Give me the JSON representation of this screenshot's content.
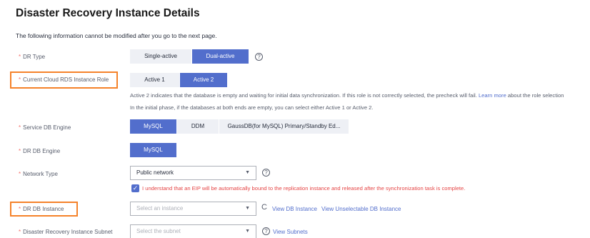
{
  "page": {
    "title": "Disaster Recovery Instance Details",
    "subtitle": "The following information cannot be modified after you go to the next page."
  },
  "fields": {
    "dr_type": {
      "label": "DR Type",
      "options": [
        "Single-active",
        "Dual-active"
      ],
      "selected": "Dual-active"
    },
    "rds_role": {
      "label": "Current Cloud RDS Instance Role",
      "options": [
        "Active 1",
        "Active 2"
      ],
      "selected": "Active 2",
      "note_prefix": "Active 2 indicates that the database is empty and waiting for initial data synchronization. If this role is not correctly selected, the precheck will fail.",
      "note_link": "Learn more",
      "note_suffix": "about the role selection",
      "note2": "In the initial phase, if the databases at both ends are empty, you can select either Active 1 or Active 2."
    },
    "service_engine": {
      "label": "Service DB Engine",
      "options": [
        "MySQL",
        "DDM",
        "GaussDB(for MySQL) Primary/Standby Ed..."
      ],
      "selected": "MySQL"
    },
    "dr_engine": {
      "label": "DR DB Engine",
      "options": [
        "MySQL"
      ],
      "selected": "MySQL"
    },
    "network_type": {
      "label": "Network Type",
      "value": "Public network",
      "checkbox_text": "I understand that an EIP will be automatically bound to the replication instance and released after the synchronization task is complete."
    },
    "dr_instance": {
      "label": "DR DB Instance",
      "placeholder": "Select an instance",
      "link_view": "View DB Instance",
      "link_unselectable": "View Unselectable DB Instance"
    },
    "subnet": {
      "label": "Disaster Recovery Instance Subnet",
      "placeholder": "Select the subnet",
      "link": "View Subnets"
    }
  },
  "colors": {
    "accent": "#526ecc",
    "highlight": "#f5822a",
    "required": "#f66f6a",
    "warning": "#e54545"
  },
  "icons": [
    "help-icon",
    "refresh-icon",
    "check-icon",
    "caret-down-icon"
  ]
}
